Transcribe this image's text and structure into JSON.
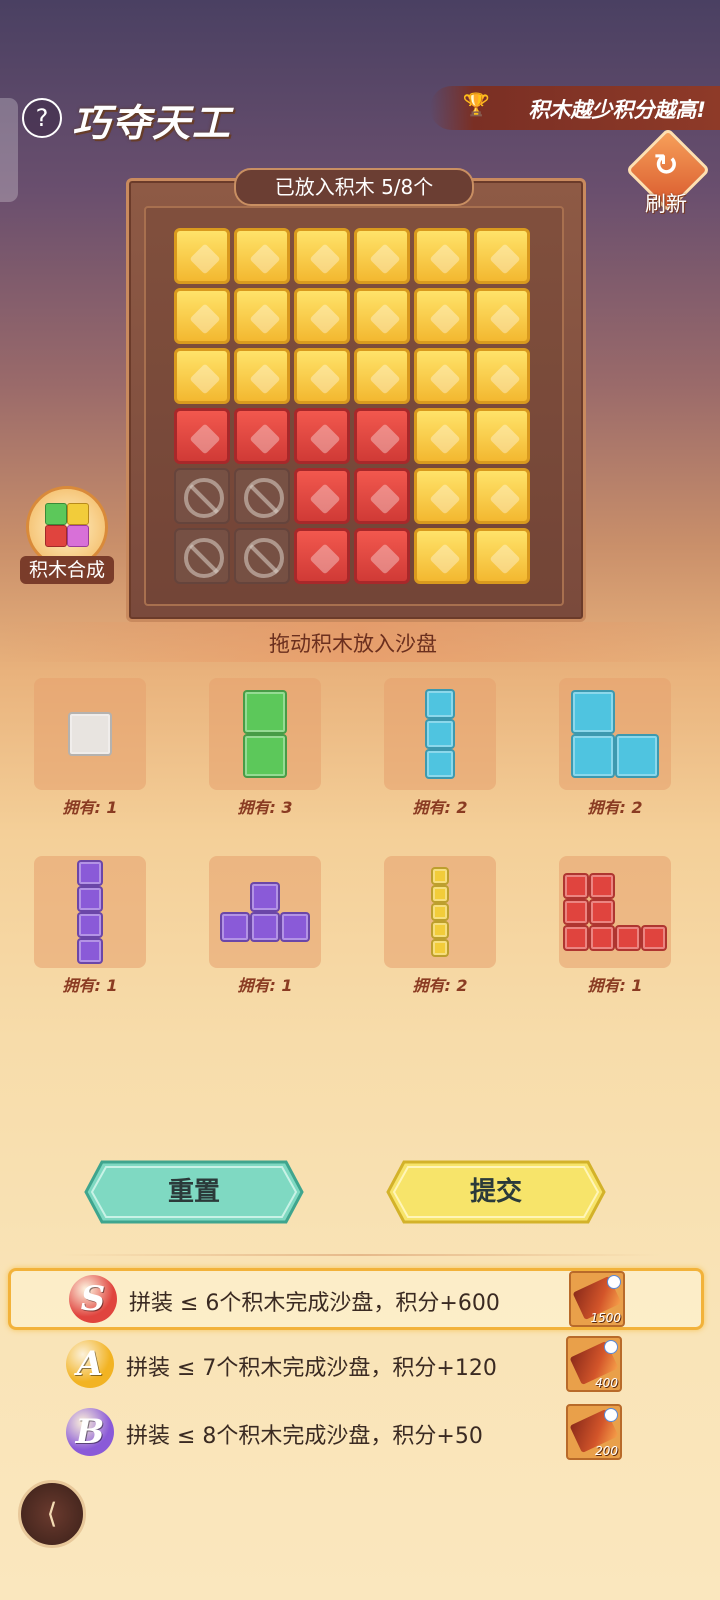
{
  "header": {
    "help_glyph": "?",
    "title": "巧夺天工",
    "banner_text": "积木越少积分越高!",
    "refresh_label": "刷新"
  },
  "board": {
    "placed_label": "已放入积木 5/8个",
    "rows": [
      [
        "yellow",
        "yellow",
        "yellow",
        "yellow",
        "yellow",
        "yellow"
      ],
      [
        "yellow",
        "yellow",
        "yellow",
        "yellow",
        "yellow",
        "yellow"
      ],
      [
        "yellow",
        "yellow",
        "yellow",
        "yellow",
        "yellow",
        "yellow"
      ],
      [
        "red",
        "red",
        "red",
        "red",
        "yellow",
        "yellow"
      ],
      [
        "blocked",
        "blocked",
        "red",
        "red",
        "yellow",
        "yellow"
      ],
      [
        "blocked",
        "blocked",
        "red",
        "red",
        "yellow",
        "yellow"
      ]
    ]
  },
  "merge": {
    "label": "积木合成"
  },
  "drag_hint": "拖动积木放入沙盘",
  "pieces": [
    {
      "shape": "single",
      "color": "#e8e4e0",
      "owned": "拥有: 1"
    },
    {
      "shape": "vertical-2",
      "color": "#5cc85a",
      "owned": "拥有: 3"
    },
    {
      "shape": "vertical-3",
      "color": "#4fc4e0",
      "owned": "拥有: 2"
    },
    {
      "shape": "L-3",
      "color": "#4fc4e0",
      "owned": "拥有: 2"
    },
    {
      "shape": "vertical-4",
      "color": "#8a5ad8",
      "owned": "拥有: 1"
    },
    {
      "shape": "T-4",
      "color": "#8a5ad8",
      "owned": "拥有: 1"
    },
    {
      "shape": "vertical-5-thin",
      "color": "#f2cc3a",
      "owned": "拥有: 2"
    },
    {
      "shape": "L-big",
      "color": "#e0443e",
      "owned": "拥有: 1"
    }
  ],
  "actions": {
    "reset_label": "重置",
    "reset_color": "#7fd9c2",
    "submit_label": "提交",
    "submit_color": "#f7e46a"
  },
  "rewards": [
    {
      "grade": "S",
      "color": "#e0443e",
      "text": "拼装 ≤ 6个积木完成沙盘，积分+600",
      "item_count": "1500",
      "highlighted": true
    },
    {
      "grade": "A",
      "color": "#f2b323",
      "text": "拼装 ≤ 7个积木完成沙盘，积分+120",
      "item_count": "400",
      "highlighted": false
    },
    {
      "grade": "B",
      "color": "#8a5ad8",
      "text": "拼装 ≤ 8个积木完成沙盘，积分+50",
      "item_count": "200",
      "highlighted": false
    }
  ],
  "back_icon": "back-arrow-icon"
}
